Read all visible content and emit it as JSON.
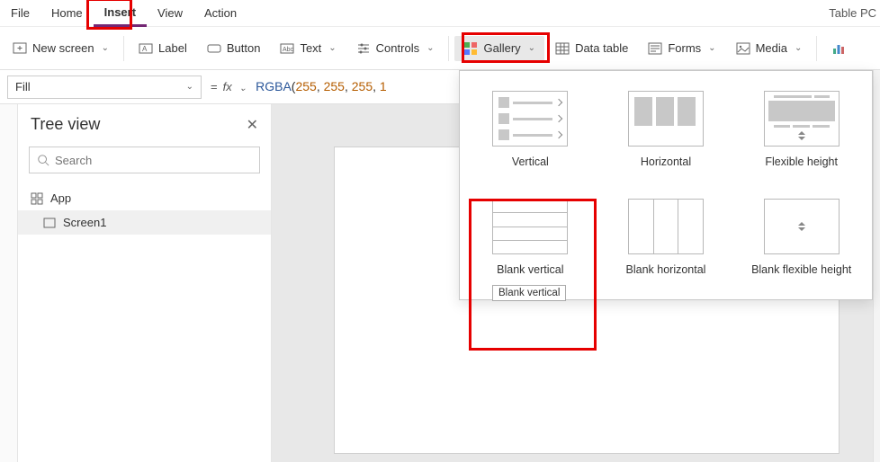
{
  "menubar": {
    "items": [
      "File",
      "Home",
      "Insert",
      "View",
      "Action"
    ],
    "active_index": 2,
    "right_text": "Table PC"
  },
  "toolbar": {
    "new_screen": "New screen",
    "label": "Label",
    "button": "Button",
    "text": "Text",
    "controls": "Controls",
    "gallery": "Gallery",
    "data_table": "Data table",
    "forms": "Forms",
    "media": "Media"
  },
  "formula": {
    "property": "Fill",
    "fn": "RGBA",
    "args": [
      "255",
      "255",
      "255",
      "1"
    ]
  },
  "tree": {
    "title": "Tree view",
    "search_placeholder": "Search",
    "items": [
      {
        "label": "App",
        "indent": 0
      },
      {
        "label": "Screen1",
        "indent": 1,
        "selected": true
      }
    ]
  },
  "gallery_dropdown": {
    "options": [
      {
        "label": "Vertical",
        "kind": "vertical"
      },
      {
        "label": "Horizontal",
        "kind": "horizontal"
      },
      {
        "label": "Flexible height",
        "kind": "flexible"
      },
      {
        "label": "Blank vertical",
        "kind": "blank-vertical"
      },
      {
        "label": "Blank horizontal",
        "kind": "blank-horizontal"
      },
      {
        "label": "Blank flexible height",
        "kind": "blank-flexible"
      }
    ],
    "tooltip": "Blank vertical"
  }
}
